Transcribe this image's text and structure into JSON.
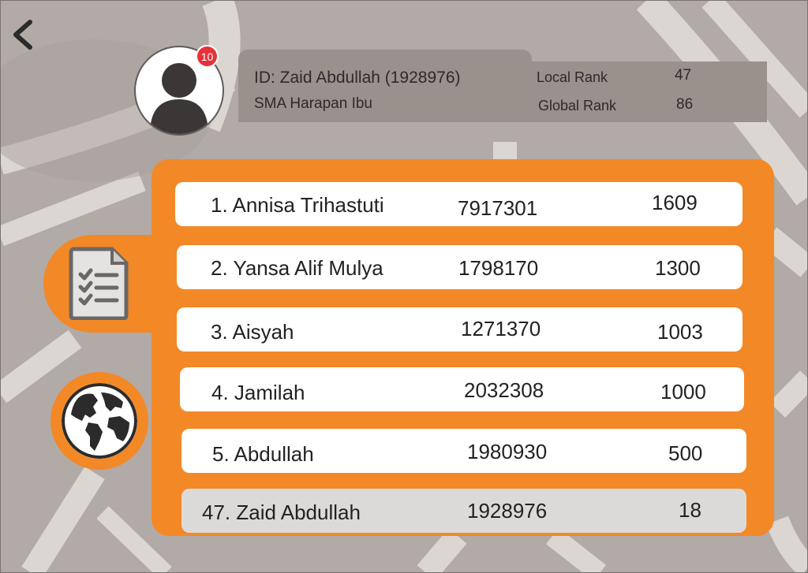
{
  "header": {
    "back_label": "",
    "notification_count": "10",
    "profile": {
      "id_line": "ID: Zaid Abdullah (1928976)",
      "school": "SMA Harapan Ibu",
      "local_rank_label": "Local Rank",
      "local_rank_value": "47",
      "global_rank_label": "Global Rank",
      "global_rank_value": "86"
    }
  },
  "sidebar": {
    "tabs": [
      {
        "icon": "checklist-icon",
        "active": true
      },
      {
        "icon": "globe-icon",
        "active": false
      }
    ]
  },
  "leaderboard": {
    "rows": [
      {
        "name": "1. Annisa Trihastuti",
        "id": "7917301",
        "score": "1609"
      },
      {
        "name": "2. Yansa Alif Mulya",
        "id": "1798170",
        "score": "1300"
      },
      {
        "name": "3. Aisyah",
        "id": "1271370",
        "score": "1003"
      },
      {
        "name": "4. Jamilah",
        "id": "2032308",
        "score": "1000"
      },
      {
        "name": "5. Abdullah",
        "id": "1980930",
        "score": "500"
      },
      {
        "name": "47. Zaid Abdullah",
        "id": "1928976",
        "score": "18"
      }
    ]
  },
  "colors": {
    "background": "#b2aaa6",
    "roads": "#dcd6d2",
    "accent": "#f38826",
    "panel": "#9a908c",
    "badge": "#e53238",
    "current_user_row": "#dcdad8"
  }
}
